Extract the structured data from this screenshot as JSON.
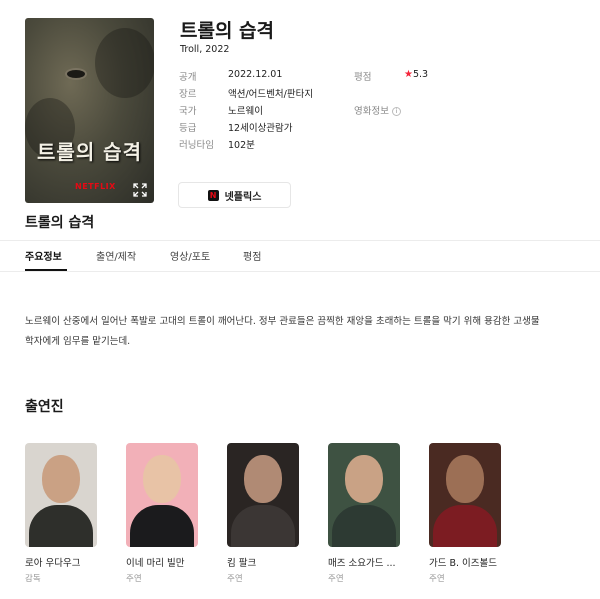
{
  "movie": {
    "title": "트롤의 습격",
    "subtitle": "Troll, 2022",
    "poster": {
      "title_text": "트롤의 습격",
      "brand_text": "NETFLIX",
      "expand_icon": "expand-icon"
    }
  },
  "info": {
    "labels": {
      "release": "공개",
      "genre": "장르",
      "country": "국가",
      "rating_grade": "등급",
      "runtime": "러닝타임",
      "score": "평점",
      "film_info": "영화정보"
    },
    "values": {
      "release": "2022.12.01",
      "genre": "액션/어드벤처/판타지",
      "country": "노르웨이",
      "rating_grade": "12세이상관람가",
      "runtime": "102분",
      "score": "5.3",
      "info_badge": "i"
    },
    "star_icon": "★"
  },
  "provider": {
    "label": "넷플릭스",
    "logo_letter": "N"
  },
  "section_title": "트롤의 습격",
  "tabs": [
    {
      "label": "주요정보"
    },
    {
      "label": "출연/제작"
    },
    {
      "label": "영상/포토"
    },
    {
      "label": "평점"
    }
  ],
  "synopsis": "노르웨이 산중에서 일어난 폭발로 고대의 트롤이 깨어난다. 정부 관료들은 끔찍한 재앙을 초래하는 트롤을 막기 위해 용감한 고생물학자에게 임무를 맡기는데.",
  "cast_title": "출연진",
  "cast": [
    {
      "name": "로아 우다우그",
      "role": "감독"
    },
    {
      "name": "이네 마리 빌만",
      "role": "주연"
    },
    {
      "name": "킴 팔크",
      "role": "주연"
    },
    {
      "name": "매즈 소요가드 ...",
      "role": "주연"
    },
    {
      "name": "가드 B. 이즈볼드",
      "role": "주연"
    }
  ],
  "colors": {
    "accent_red": "#f4253b",
    "netflix_red": "#e50914"
  }
}
